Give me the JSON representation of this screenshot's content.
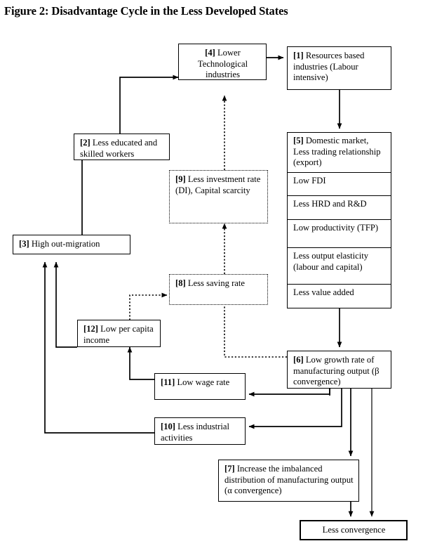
{
  "figure": {
    "title": "Figure 2: Disadvantage Cycle in the Less Developed States"
  },
  "nodes": {
    "n4": {
      "index": "[4]",
      "text": "[4] Lower Technological industries",
      "style": "solid"
    },
    "n1": {
      "index": "[1]",
      "text": "[1] Resources based industries (Labour intensive)",
      "style": "solid"
    },
    "n2": {
      "index": "[2]",
      "text": "[2] Less educated and skilled workers",
      "style": "solid"
    },
    "n9": {
      "index": "[9]",
      "text": "[9] Less investment rate (DI), Capital scarcity",
      "style": "dotted"
    },
    "n3": {
      "index": "[3]",
      "text": "[3] High out-migration",
      "style": "solid"
    },
    "n8": {
      "index": "[8]",
      "text": "[8] Less saving rate",
      "style": "dotted"
    },
    "n12": {
      "index": "[12]",
      "text": "[12] Low per capita income",
      "style": "solid"
    },
    "n11": {
      "index": "[11]",
      "text": "[11] Low wage rate",
      "style": "solid"
    },
    "n10": {
      "index": "[10]",
      "text": "[10] Less industrial activities",
      "style": "solid"
    },
    "n6": {
      "index": "[6]",
      "text": "[6] Low growth rate of manufacturing output (β convergence)",
      "style": "solid"
    },
    "n7": {
      "index": "[7]",
      "text": "[7] Increase the imbalanced distribution of manufacturing output (α convergence)",
      "style": "solid"
    },
    "nfinal": {
      "index": "",
      "text": "Less convergence",
      "style": "thick"
    }
  },
  "stack5": {
    "rows": [
      "[5] Domestic market, Less trading relationship (export)",
      "Low FDI",
      "Less HRD and R&D",
      "Low productivity (TFP)",
      "Less output elasticity (labour and capital)",
      "Less value added"
    ]
  },
  "chart_data": {
    "type": "diagram",
    "title": "Figure 2: Disadvantage Cycle in the Less Developed States",
    "nodes": [
      {
        "id": "1",
        "label": "Resources based industries (Labour intensive)",
        "border": "solid"
      },
      {
        "id": "2",
        "label": "Less educated and skilled workers",
        "border": "solid"
      },
      {
        "id": "3",
        "label": "High out-migration",
        "border": "solid"
      },
      {
        "id": "4",
        "label": "Lower Technological industries",
        "border": "solid"
      },
      {
        "id": "5",
        "label": "Domestic market, Less trading relationship (export); Low FDI; Less HRD and R&D; Low productivity (TFP); Less output elasticity (labour and capital); Less value added",
        "border": "solid"
      },
      {
        "id": "6",
        "label": "Low growth rate of manufacturing output (β convergence)",
        "border": "solid"
      },
      {
        "id": "7",
        "label": "Increase the imbalanced distribution of manufacturing output (α convergence)",
        "border": "solid"
      },
      {
        "id": "8",
        "label": "Less saving rate",
        "border": "dotted"
      },
      {
        "id": "9",
        "label": "Less investment rate (DI), Capital scarcity",
        "border": "dotted"
      },
      {
        "id": "10",
        "label": "Less industrial activities",
        "border": "solid"
      },
      {
        "id": "11",
        "label": "Low wage rate",
        "border": "solid"
      },
      {
        "id": "12",
        "label": "Low per capita income",
        "border": "solid"
      },
      {
        "id": "final",
        "label": "Less convergence",
        "border": "thick"
      }
    ],
    "edges": [
      {
        "from": "4",
        "to": "1",
        "style": "solid"
      },
      {
        "from": "1",
        "to": "5",
        "style": "solid"
      },
      {
        "from": "5",
        "to": "6",
        "style": "solid"
      },
      {
        "from": "6",
        "to": "11",
        "style": "solid"
      },
      {
        "from": "6",
        "to": "10",
        "style": "solid"
      },
      {
        "from": "6",
        "to": "7",
        "style": "solid"
      },
      {
        "from": "6",
        "to": "final",
        "style": "solid"
      },
      {
        "from": "6",
        "to": "8",
        "style": "dotted"
      },
      {
        "from": "7",
        "to": "final",
        "style": "solid"
      },
      {
        "from": "11",
        "to": "12",
        "style": "solid"
      },
      {
        "from": "10",
        "to": "3",
        "style": "solid"
      },
      {
        "from": "12",
        "to": "3",
        "style": "solid"
      },
      {
        "from": "12",
        "to": "8",
        "style": "dotted"
      },
      {
        "from": "3",
        "to": "2",
        "style": "solid"
      },
      {
        "from": "2",
        "to": "4",
        "style": "solid"
      },
      {
        "from": "8",
        "to": "9",
        "style": "dotted"
      },
      {
        "from": "9",
        "to": "4",
        "style": "dotted"
      }
    ]
  }
}
